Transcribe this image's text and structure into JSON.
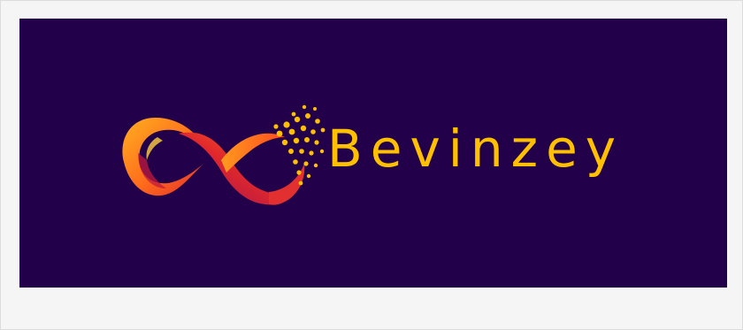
{
  "logo": {
    "brand_name": "Bevinzey",
    "mark_icon": "infinity-swirl-icon",
    "colors": {
      "background": "#22004a",
      "wordmark": "#ffc000",
      "gradient_start": "#ff9a1f",
      "gradient_mid": "#ff4b1f",
      "gradient_end": "#b3124e",
      "dots": "#ffc000"
    }
  }
}
